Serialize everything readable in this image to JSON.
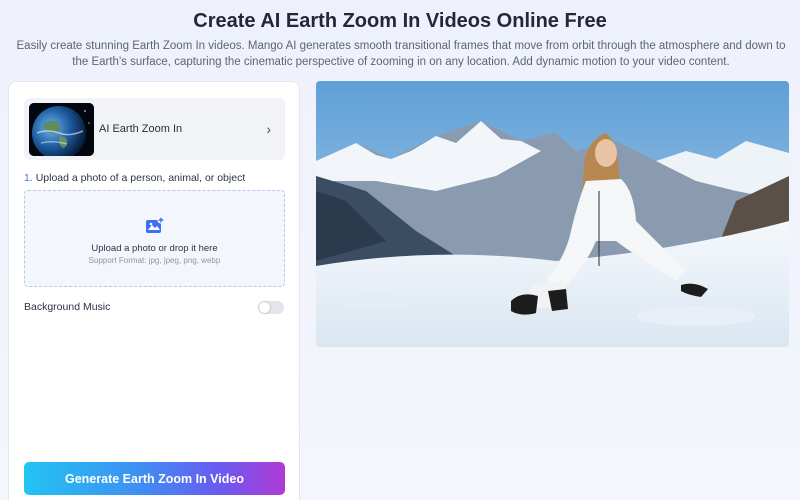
{
  "page": {
    "title": "Create AI Earth Zoom In Videos Online Free",
    "subtitle": "Easily create stunning Earth Zoom In videos. Mango AI generates smooth transitional frames that move from orbit through the atmosphere and down to the Earth's surface, capturing the cinematic perspective of zooming in on any location. Add dynamic motion to your video content."
  },
  "panel": {
    "model": {
      "label": "AI Earth Zoom In",
      "thumbnail_icon": "earth-image",
      "chevron_icon": "chevron-right-icon"
    },
    "step": {
      "number": "1.",
      "text": "Upload a photo of a person, animal, or object"
    },
    "upload": {
      "icon": "image-add-icon",
      "text": "Upload a photo or drop it here",
      "formats": "Support Format: jpg, jpeg, png, webp"
    },
    "music": {
      "label": "Background Music",
      "enabled": false
    },
    "generate_label": "Generate Earth Zoom In Video"
  },
  "preview": {
    "image": "woman-sitting-in-snow-mountains"
  },
  "colors": {
    "accent": "#3d6ff5",
    "gradient_start": "#22c4f2",
    "gradient_end": "#b03ad6"
  }
}
